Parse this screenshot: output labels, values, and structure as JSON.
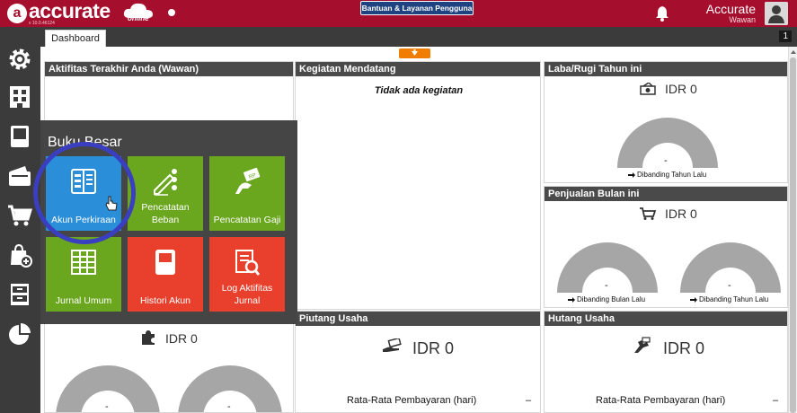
{
  "header": {
    "logo_text": "accurate",
    "logo_sub": "online",
    "logo_version": "v 10.0.46124",
    "help_button": "Bantuan & Layanan Pengguna",
    "user_name": "Accurate",
    "user_sub": "Wawan"
  },
  "tabs": {
    "active": "Dashboard",
    "count": "1"
  },
  "panels": {
    "aktifitas": {
      "title": "Aktifitas Terakhir Anda (Wawan)"
    },
    "kegiatan": {
      "title": "Kegiatan Mendatang",
      "empty": "Tidak ada kegiatan"
    },
    "labarugi": {
      "title": "Laba/Rugi Tahun ini",
      "value": "IDR 0",
      "gauge_value": "-",
      "compare": "Dibanding Tahun Lalu"
    },
    "penjualan": {
      "title": "Penjualan Bulan ini",
      "value": "IDR 0",
      "gauge1_value": "-",
      "gauge2_value": "-",
      "compare1": "Dibanding Bulan Lalu",
      "compare2": "Dibanding Tahun Lalu"
    },
    "bottom_left": {
      "value": "IDR 0",
      "gauge1_value": "-",
      "gauge2_value": "-"
    },
    "piutang": {
      "title": "Piutang Usaha",
      "value": "IDR 0",
      "avg_label": "Rata-Rata Pembayaran (hari)",
      "avg_value": "–"
    },
    "hutang": {
      "title": "Hutang Usaha",
      "value": "IDR 0",
      "avg_label": "Rata-Rata Pembayaran (hari)",
      "avg_value": "–"
    }
  },
  "menu": {
    "title": "Buku Besar",
    "tiles": [
      {
        "label": "Akun Perkiraan",
        "color": "#2a8ed8",
        "icon": "ledger-book-icon"
      },
      {
        "label": "Pencatatan Beban",
        "color": "#6aa61e",
        "icon": "expense-pen-icon"
      },
      {
        "label": "Pencatatan Gaji",
        "color": "#6aa61e",
        "icon": "salary-hand-icon"
      },
      {
        "label": "Jurnal Umum",
        "color": "#6aa61e",
        "icon": "journal-grid-icon"
      },
      {
        "label": "Histori Akun",
        "color": "#e8402c",
        "icon": "history-book-icon"
      },
      {
        "label": "Log Aktifitas Jurnal",
        "color": "#e8402c",
        "icon": "log-search-icon"
      }
    ]
  },
  "sidebar": {
    "items": [
      "gear-icon",
      "building-icon",
      "ledger-icon",
      "wallet-icon",
      "cart-icon",
      "bag-plus-icon",
      "archive-icon",
      "pie-chart-icon"
    ]
  },
  "colors": {
    "brand": "#a50f2d",
    "accent_orange": "#f07c00",
    "ring": "#3a3ec0"
  }
}
